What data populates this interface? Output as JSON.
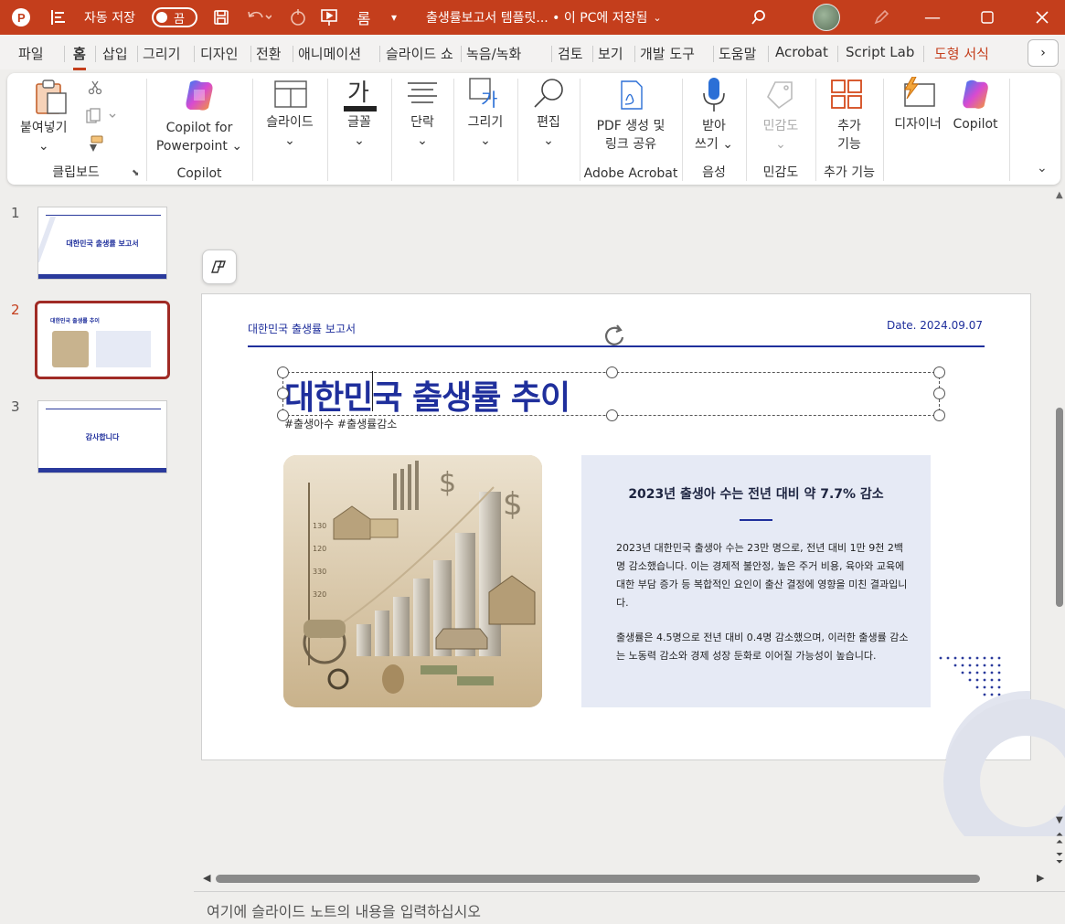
{
  "titlebar": {
    "autosave_label": "자동 저장",
    "autosave_state": "끔",
    "doc_title": "출생률보고서 템플릿... • 이 PC에 저장됨",
    "bg": "#c43e1c"
  },
  "tabs": [
    "파일",
    "홈",
    "삽입",
    "그리기",
    "디자인",
    "전환",
    "애니메이션",
    "슬라이드 쇼",
    "녹음/녹화",
    "검토",
    "보기",
    "개발 도구",
    "도움말",
    "Acrobat",
    "Script Lab",
    "도형 서식"
  ],
  "ribbon": {
    "clipboard": {
      "paste": "붙여넣기",
      "label": "클립보드"
    },
    "copilot": {
      "button": "Copilot for",
      "button2": "Powerpoint",
      "label": "Copilot"
    },
    "slides": "슬라이드",
    "font": "글꼴",
    "paragraph": "단락",
    "drawing": "그리기",
    "editing": "편집",
    "acrobat": {
      "button": "PDF 생성 및",
      "button2": "링크 공유",
      "label": "Adobe Acrobat"
    },
    "voice": {
      "button": "받아",
      "button2": "쓰기",
      "label": "음성"
    },
    "sensitivity": {
      "button": "민감도",
      "label": "민감도"
    },
    "addins": {
      "button": "추가",
      "button2": "기능",
      "label": "추가 기능"
    },
    "designer": "디자이너",
    "copilot2": "Copilot"
  },
  "thumbnails": [
    {
      "num": "1",
      "title": "대한민국 출생률 보고서"
    },
    {
      "num": "2",
      "title": "대한민국 출생률 추이"
    },
    {
      "num": "3",
      "title": "감사합니다"
    }
  ],
  "slide": {
    "header_left": "대한민국 출생률 보고서",
    "header_right": "Date. 2024.09.07",
    "title": "대한민국 출생률 추이",
    "tags": "#출생아수 #출생률감소",
    "info_title": "2023년 출생아 수는 전년 대비 약 7.7% 감소",
    "info_p1": "2023년 대한민국 출생아 수는 23만 명으로, 전년 대비 1만 9천 2백명 감소했습니다. 이는 경제적 불안정, 높은 주거 비용, 육아와 교육에 대한 부담 증가 등 복합적인 요인이 출산 결정에 영향을 미친 결과입니다.",
    "info_p2": "출생률은 4.5명으로 전년 대비 0.4명 감소했으며, 이러한 출생률 감소는 노동력 감소와 경제 성장 둔화로 이어질 가능성이 높습니다.",
    "accent": "#1f2f9c"
  },
  "notes": {
    "placeholder": "여기에 슬라이드 노트의 내용을 입력하십시오"
  }
}
